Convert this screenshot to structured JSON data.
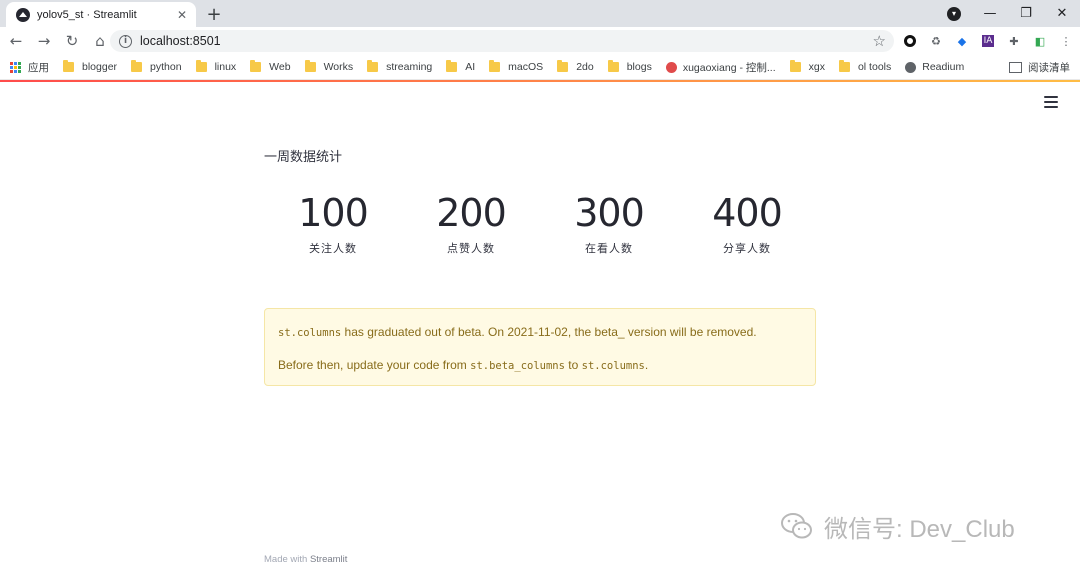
{
  "browser": {
    "tab_title": "yolov5_st · Streamlit",
    "url": "localhost:8501",
    "bookmarks": [
      {
        "label": "应用",
        "icon": "apps-icon"
      },
      {
        "label": "blogger",
        "icon": "folder-icon"
      },
      {
        "label": "python",
        "icon": "folder-icon"
      },
      {
        "label": "linux",
        "icon": "folder-icon"
      },
      {
        "label": "Web",
        "icon": "folder-icon"
      },
      {
        "label": "Works",
        "icon": "folder-icon"
      },
      {
        "label": "streaming",
        "icon": "folder-icon"
      },
      {
        "label": "AI",
        "icon": "folder-icon"
      },
      {
        "label": "macOS",
        "icon": "folder-icon"
      },
      {
        "label": "2do",
        "icon": "folder-icon"
      },
      {
        "label": "blogs",
        "icon": "folder-icon"
      },
      {
        "label": "xugaoxiang - 控制...",
        "icon": "gear-icon"
      },
      {
        "label": "xgx",
        "icon": "folder-icon"
      },
      {
        "label": "ol tools",
        "icon": "folder-icon"
      },
      {
        "label": "Readium",
        "icon": "globe-icon"
      }
    ],
    "reading_list": "阅读清单",
    "extensions": [
      "IA"
    ]
  },
  "main": {
    "title": "一周数据统计",
    "metrics": [
      {
        "value": "100",
        "label": "关注人数"
      },
      {
        "value": "200",
        "label": "点赞人数"
      },
      {
        "value": "300",
        "label": "在看人数"
      },
      {
        "value": "400",
        "label": "分享人数"
      }
    ],
    "alert": {
      "code1": "st.columns",
      "text1": " has graduated out of beta. On 2021-11-02, the beta_ version will be removed.",
      "text2a": "Before then, update your code from ",
      "code2": "st.beta_columns",
      "text2b": " to ",
      "code3": "st.columns",
      "text2c": "."
    },
    "footer_prefix": "Made with ",
    "footer_brand": "Streamlit"
  },
  "watermark": "微信号: Dev_Club",
  "colors": {
    "accent_start": "#ff4b4b",
    "accent_end": "#ffbd45",
    "alert_bg": "#fffae4",
    "alert_text": "#886c1a"
  }
}
